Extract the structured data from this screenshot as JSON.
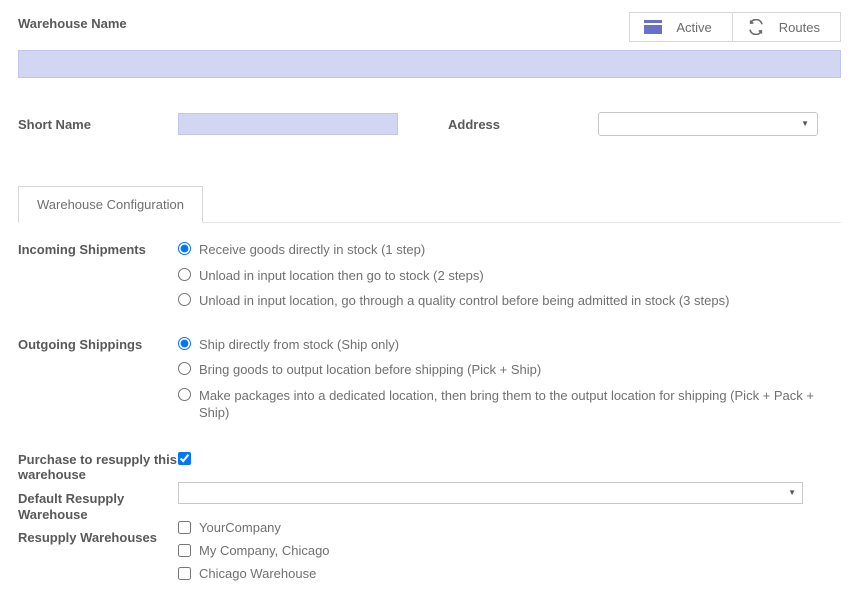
{
  "header": {
    "warehouse_name_label": "Warehouse Name",
    "active_label": "Active",
    "routes_label": "Routes",
    "warehouse_name_value": ""
  },
  "row2": {
    "short_name_label": "Short Name",
    "short_name_value": "",
    "address_label": "Address",
    "address_value": ""
  },
  "tabs": {
    "config_label": "Warehouse Configuration"
  },
  "incoming": {
    "label": "Incoming Shipments",
    "options": [
      "Receive goods directly in stock (1 step)",
      "Unload in input location then go to stock (2 steps)",
      "Unload in input location, go through a quality control before being admitted in stock (3 steps)"
    ]
  },
  "outgoing": {
    "label": "Outgoing Shippings",
    "options": [
      "Ship directly from stock (Ship only)",
      "Bring goods to output location before shipping (Pick + Ship)",
      "Make packages into a dedicated location, then bring them to the output location for shipping (Pick + Pack + Ship)"
    ]
  },
  "resupply": {
    "purchase_label": "Purchase to resupply this warehouse",
    "default_label": "Default Resupply Warehouse",
    "default_value": "",
    "list_label": "Resupply Warehouses",
    "items": [
      "YourCompany",
      "My Company, Chicago",
      "Chicago Warehouse"
    ]
  }
}
